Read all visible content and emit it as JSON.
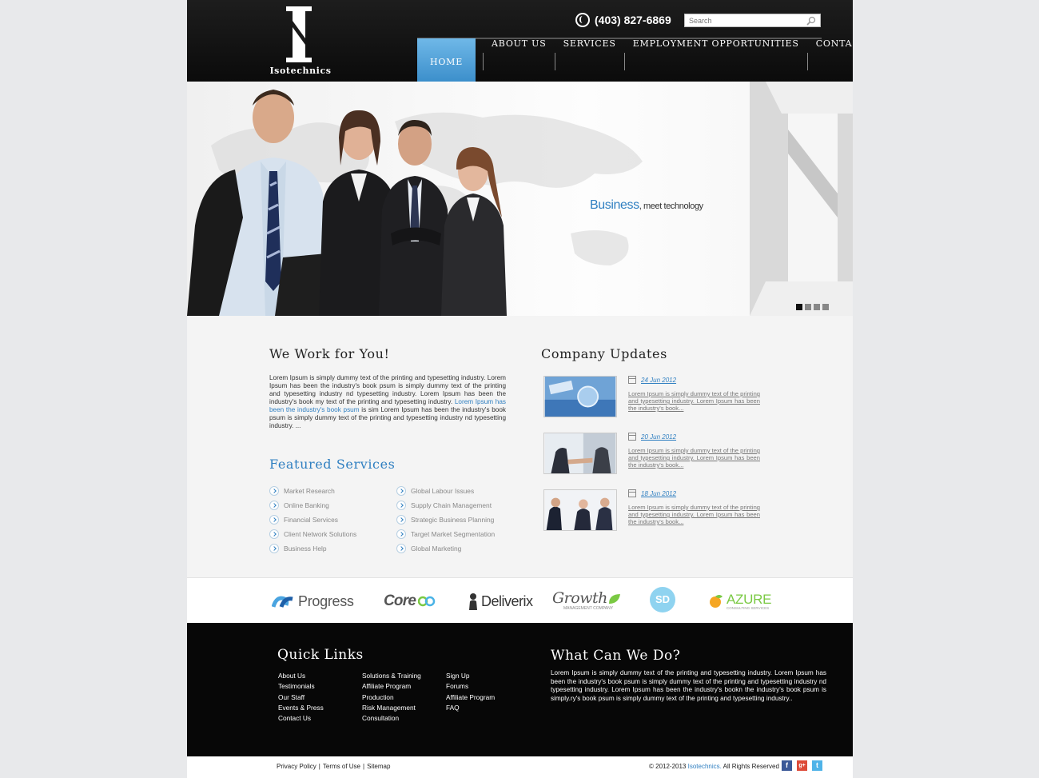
{
  "header": {
    "logo_text": "Isotechnics",
    "phone": "(403) 827-6869",
    "search_placeholder": "Search",
    "nav": [
      {
        "label": "HOME",
        "active": true
      },
      {
        "label": "ABOUT US"
      },
      {
        "label": "SERVICES"
      },
      {
        "label": "EMPLOYMENT OPPORTUNITIES"
      },
      {
        "label": "CONTACT US"
      }
    ]
  },
  "hero": {
    "tagline_main": "Business",
    "tagline_rest": ", meet technology",
    "slides": 4,
    "active_slide": 1
  },
  "work": {
    "title": "We Work for You!",
    "intro_before": "Lorem Ipsum is simply dummy text of the printing and typesetting industry. Lorem Ipsum has been the industry's book psum is simply dummy text of the printing and typesetting industry nd typesetting industry. Lorem Ipsum has been the industry's book my text of the printing and typesetting industry. ",
    "intro_link": "Lorem Ipsum has been the industry's book psum",
    "intro_after": " is sim Lorem Ipsum has been the industry's book psum is simply dummy text of the printing and typesetting industry nd typesetting industry. ..."
  },
  "featured": {
    "title": "Featured Services",
    "col1": [
      "Market Research",
      "Online Banking",
      "Financial Services",
      "Client Network Solutions",
      "Business Help"
    ],
    "col2": [
      "Global Labour Issues",
      "Supply Chain Management",
      "Strategic Business Planning",
      "Target Market Segmentation",
      "Global Marketing"
    ]
  },
  "updates": {
    "title": "Company Updates",
    "items": [
      {
        "date": "24 Jun 2012",
        "text": "Lorem Ipsum is simply dummy text of the printing and typesetting industry. Lorem Ipsum has been the industry's book..."
      },
      {
        "date": "20 Jun 2012",
        "text": "Lorem Ipsum is simply dummy text of the printing and typesetting industry. Lorem Ipsum has been the industry's book..."
      },
      {
        "date": "18 Jun 2012",
        "text": "Lorem Ipsum is simply dummy text of the printing and typesetting industry. Lorem Ipsum has been the industry's book..."
      }
    ]
  },
  "partners": {
    "progress": "Progress",
    "core": "Core",
    "deliverix": "Deliverix",
    "growth": "Growth",
    "growth_sub": "MANAGEMENT COMPANY",
    "sd": "SD",
    "azure": "AZURE",
    "azure_sub": "CONSULTING SERVICES"
  },
  "footer": {
    "quick_links_title": "Quick Links",
    "col1": [
      "About Us",
      "Testimonials",
      "Our Staff",
      "Events & Press",
      "Contact Us"
    ],
    "col2": [
      "Solutions & Training",
      "Affiliate Program",
      "Production",
      "Risk Management",
      "Consultation"
    ],
    "col3": [
      "Sign Up",
      "Forums",
      "Affiliate Program",
      "FAQ"
    ],
    "what_title": "What Can We Do?",
    "what_text": "Lorem Ipsum is simply dummy text of the printing and typesetting industry. Lorem Ipsum has been the industry's book psum is simply dummy text of the printing and typesetting industry nd typesetting industry. Lorem Ipsum has been the industry's bookn the industry's book psum is simply.ry's book psum is simply dummy text of the printing and typesetting industry.."
  },
  "bottom": {
    "privacy": "Privacy Policy",
    "terms": "Terms of Use",
    "sitemap": "Sitemap",
    "copy_before": "© 2012-2013 ",
    "copy_brand": "Isotechnics.",
    "copy_after": " All Rights Reserved",
    "social": [
      "f",
      "g+",
      "t"
    ]
  },
  "colors": {
    "accent": "#2f7fc1",
    "header_bg": "#111111",
    "footer_bg": "#070707"
  }
}
